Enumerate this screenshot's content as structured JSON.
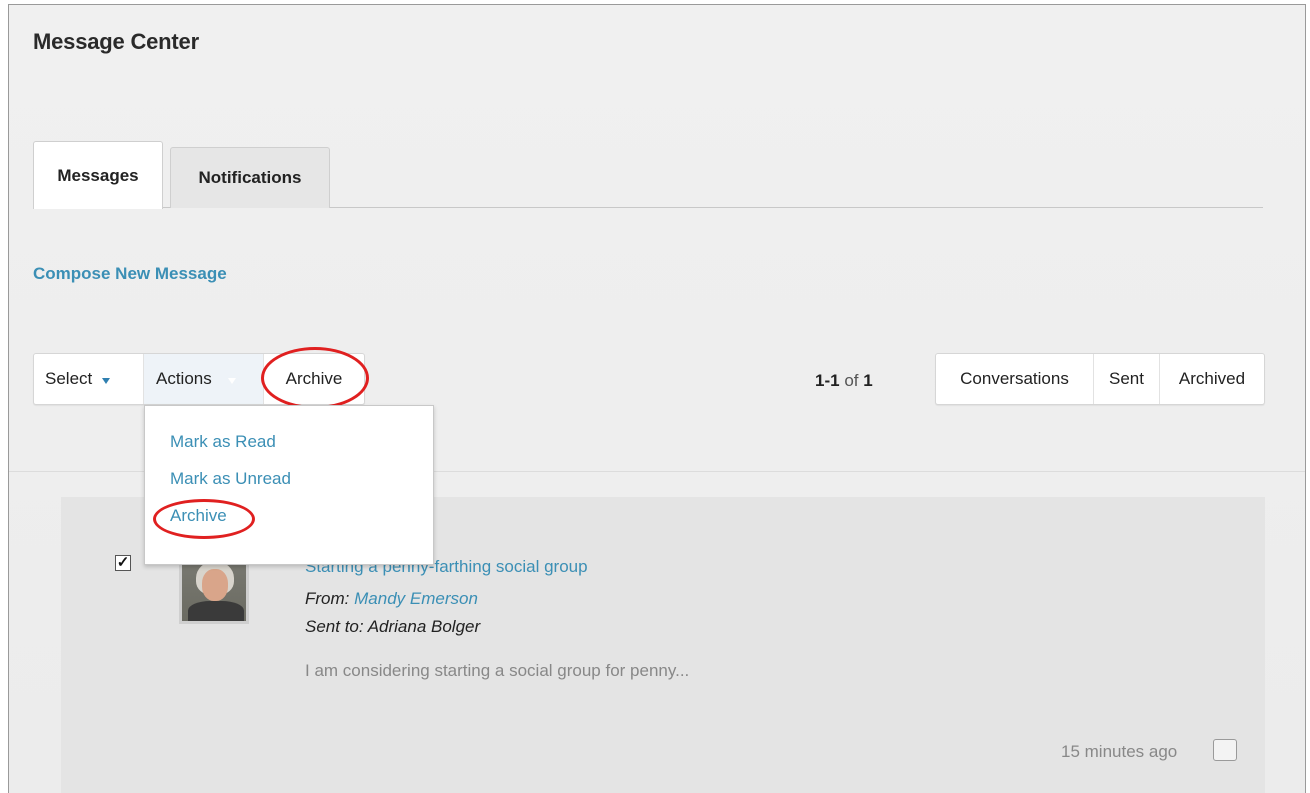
{
  "page": {
    "title": "Message Center"
  },
  "tabs": [
    {
      "label": "Messages",
      "active": true
    },
    {
      "label": "Notifications",
      "active": false
    }
  ],
  "compose_link": "Compose New Message",
  "toolbar": {
    "select_label": "Select",
    "actions_label": "Actions",
    "archive_label": "Archive"
  },
  "actions_menu": {
    "items": [
      "Mark as Read",
      "Mark as Unread",
      "Archive"
    ]
  },
  "pager": {
    "range": "1-1",
    "of_label": "of",
    "total": "1"
  },
  "views": [
    "Conversations",
    "Sent",
    "Archived"
  ],
  "message": {
    "selected": true,
    "subject": "Starting a penny-farthing social group",
    "from_label": "From:",
    "from_name": "Mandy Emerson",
    "sent_to": "Sent to: Adriana Bolger",
    "preview": "I am considering starting a social group for penny...",
    "time": "15 minutes ago",
    "icons": {
      "checkbox": "checkbox-checked-icon",
      "avatar": "user-avatar"
    }
  },
  "colors": {
    "link": "#3b8fb5",
    "highlight_annotation": "#e02020",
    "panel_bg": "#ececec"
  }
}
